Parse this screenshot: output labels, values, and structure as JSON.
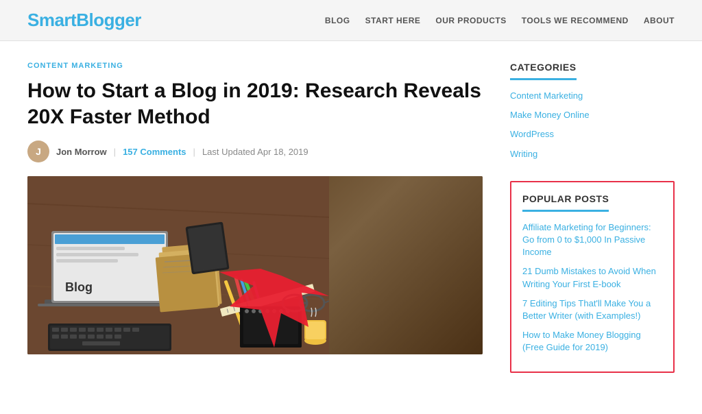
{
  "header": {
    "logo_text_black": "Smart",
    "logo_text_blue": "Blogger",
    "nav_items": [
      {
        "label": "BLOG",
        "id": "nav-blog"
      },
      {
        "label": "START HERE",
        "id": "nav-start-here"
      },
      {
        "label": "OUR PRODUCTS",
        "id": "nav-our-products"
      },
      {
        "label": "TOOLS WE RECOMMEND",
        "id": "nav-tools"
      },
      {
        "label": "ABOUT",
        "id": "nav-about"
      }
    ]
  },
  "article": {
    "category": "CONTENT MARKETING",
    "title": "How to Start a Blog in 2019: Research Reveals 20X Faster Method",
    "author": "Jon Morrow",
    "comments_count": "157 Comments",
    "last_updated": "Last Updated Apr 18, 2019",
    "blog_screen_word": "Blog"
  },
  "sidebar": {
    "categories_heading": "CATEGORIES",
    "categories": [
      {
        "label": "Content Marketing"
      },
      {
        "label": "Make Money Online"
      },
      {
        "label": "WordPress"
      },
      {
        "label": "Writing"
      }
    ],
    "popular_posts_heading": "POPULAR POSTS",
    "popular_posts": [
      {
        "label": "Affiliate Marketing for Beginners: Go from 0 to $1,000 In Passive Income"
      },
      {
        "label": "21 Dumb Mistakes to Avoid When Writing Your First E-book"
      },
      {
        "label": "7 Editing Tips That'll Make You a Better Writer (with Examples!)"
      },
      {
        "label": "How to Make Money Blogging (Free Guide for 2019)"
      }
    ]
  }
}
